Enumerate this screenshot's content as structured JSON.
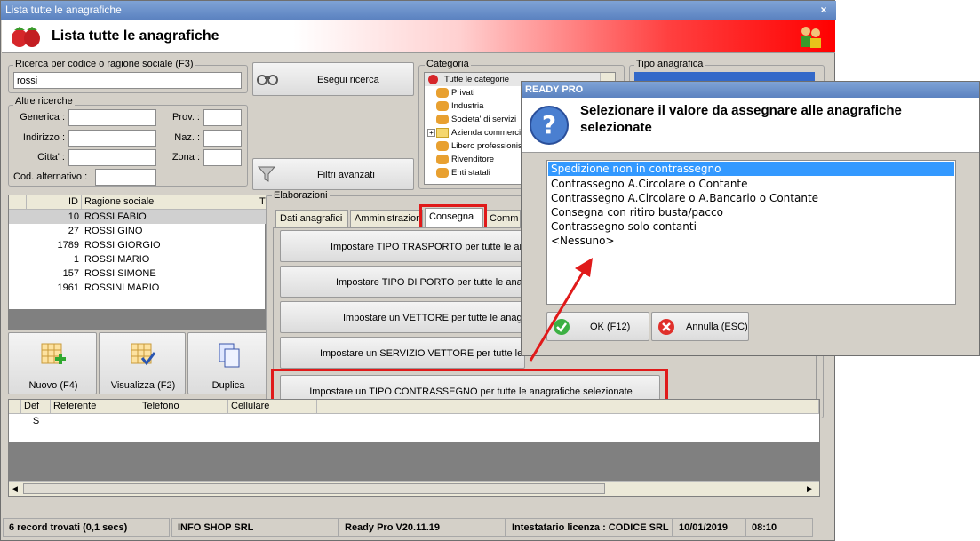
{
  "window": {
    "title": "Lista tutte le anagrafiche",
    "header_title": "Lista tutte le anagrafiche"
  },
  "search": {
    "group_label": "Ricerca per codice o ragione sociale (F3)",
    "value": "rossi",
    "search_button": "Esegui ricerca",
    "filters_button": "Filtri avanzati"
  },
  "other": {
    "group_label": "Altre ricerche",
    "generica": "Generica :",
    "prov": "Prov. :",
    "indirizzo": "Indirizzo :",
    "naz": "Naz. :",
    "citta": "Citta' :",
    "zona": "Zona :",
    "cod_alt": "Cod. alternativo :"
  },
  "categoria": {
    "label": "Categoria",
    "items": [
      "Tutte le categorie",
      "Privati",
      "Industria",
      "Societa' di servizi",
      "Azienda commerciale",
      "Libero professionista",
      "Rivenditore",
      "Enti statali"
    ]
  },
  "tipo": {
    "label": "Tipo anagrafica"
  },
  "table": {
    "headers": [
      "ID",
      "Ragione sociale",
      "Tip"
    ],
    "rows": [
      {
        "id": "10",
        "name": "ROSSI FABIO"
      },
      {
        "id": "27",
        "name": "ROSSI GINO"
      },
      {
        "id": "1789",
        "name": "ROSSI GIORGIO"
      },
      {
        "id": "1",
        "name": "ROSSI MARIO"
      },
      {
        "id": "157",
        "name": "ROSSI SIMONE"
      },
      {
        "id": "1961",
        "name": "ROSSINI MARIO"
      }
    ]
  },
  "actions": {
    "nuovo": "Nuovo (F4)",
    "visualizza": "Visualizza (F2)",
    "duplica": "Duplica"
  },
  "contacts": {
    "headers": [
      "Def",
      "Referente",
      "Telefono",
      "Cellulare"
    ],
    "row_def": "S"
  },
  "elab": {
    "label": "Elaborazioni",
    "tabs": [
      "Dati anagrafici",
      "Amministrazione",
      "Consegna",
      "Comm"
    ],
    "buttons": [
      "Impostare TIPO TRASPORTO per tutte le anagrafiche selezionate",
      "Impostare TIPO DI PORTO per tutte le anagrafiche selezionate",
      "Impostare un VETTORE per tutte le anagrafiche selezionate",
      "Impostare un SERVIZIO VETTORE per tutte le anagrafiche selezionate",
      "Impostare un TIPO CONTRASSEGNO per tutte le anagrafiche selezionate"
    ]
  },
  "status": {
    "records": "6 record trovati (0,1 secs)",
    "company": "INFO SHOP SRL",
    "version": "Ready Pro V20.11.19",
    "license": "Intestatario licenza : CODICE SRL",
    "date": "10/01/2019",
    "time": "08:10"
  },
  "dialog": {
    "title": "READY PRO",
    "message": "Selezionare il valore da assegnare alle anagrafiche selezionate",
    "options": [
      "Spedizione non in contrassegno",
      "Contrassegno A.Circolare o Contante",
      "Contrassegno A.Circolare o A.Bancario o Contante",
      "Consegna con ritiro busta/pacco",
      "Contrassegno solo contanti",
      "<Nessuno>"
    ],
    "ok": "OK (F12)",
    "cancel": "Annulla (ESC)"
  },
  "colors": {
    "highlight": "#e01a1a",
    "selection": "#3399ff",
    "title_blue": "#5b82c0"
  }
}
